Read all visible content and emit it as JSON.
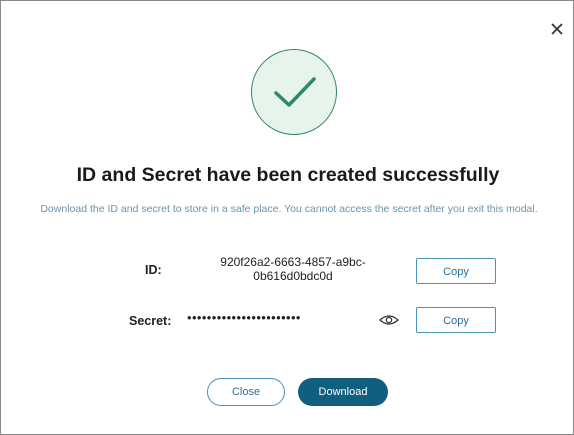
{
  "modal": {
    "title": "ID and Secret have been created successfully",
    "subtitle": "Download the ID and secret to store in a safe place. You cannot access the secret after you exit this modal.",
    "close_icon": "close-icon",
    "success_icon": "checkmark-icon"
  },
  "credentials": {
    "id_label": "ID:",
    "id_value": "920f26a2-6663-4857-a9bc-0b616d0bdc0d",
    "secret_label": "Secret:",
    "secret_masked": "•••••••••••••••••••••••",
    "reveal_icon": "eye-icon",
    "copy_label": "Copy"
  },
  "actions": {
    "close_label": "Close",
    "download_label": "Download"
  },
  "colors": {
    "accent": "#115f7e",
    "success_green": "#2f8a5d",
    "success_bg": "#e6f4ec",
    "subtitle": "#6b93ab"
  }
}
